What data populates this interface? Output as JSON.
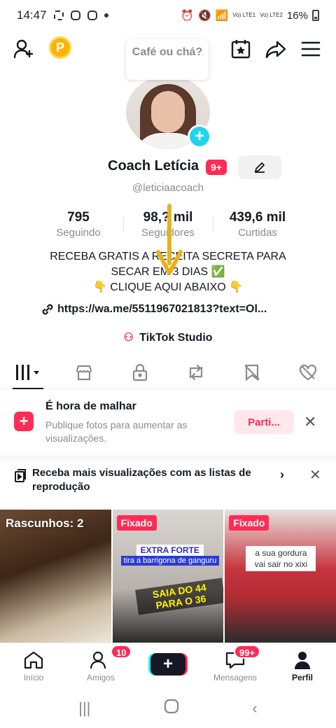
{
  "status_bar": {
    "time": "14:47",
    "sim1": "Vo) LTE1",
    "sim2": "Vo) LTE2",
    "battery": "16%"
  },
  "header": {
    "coin_letter": "P",
    "bubble_text": "Café ou chá?"
  },
  "profile": {
    "name": "Coach Letícia",
    "name_badge": "9+",
    "handle": "@leticiaacoach"
  },
  "stats": [
    {
      "value": "795",
      "label": "Seguindo"
    },
    {
      "value": "98,? mil",
      "label": "Seguidores"
    },
    {
      "value": "439,6 mil",
      "label": "Curtidas"
    }
  ],
  "bio": {
    "line1": "RECEBA GRATIS A RECEITA SECRETA PARA",
    "line2": "SECAR EM 3 DIAS ✅",
    "line3": "👇 CLIQUE AQUI ABAIXO 👇"
  },
  "link": "https://wa.me/5511967021813?text=Ol...",
  "studio_label": "TikTok Studio",
  "promo": {
    "title": "É hora de malhar",
    "subtitle": "Publique fotos para aumentar as visualizações.",
    "button": "Parti..."
  },
  "playlist_banner": "Receba mais visualizações com as listas de reprodução",
  "videos": {
    "drafts": "Rascunhos: 2",
    "pinned": "Fixado",
    "v2_overlay1": "EXTRA FORTE",
    "v2_overlay2": "tira a barrigona de ganguru",
    "v2_overlay3": "SAIA DO 44 PARA O 36",
    "v3_overlay": "a sua gordura vai sair no xixi"
  },
  "bottom_nav": {
    "home": "Início",
    "friends": "Amigos",
    "friends_count": "10",
    "messages": "Mensagens",
    "messages_count": "99+",
    "profile": "Perfil"
  },
  "colors": {
    "accent": "#fe2c55",
    "teal": "#20d5ec",
    "arrow": "#e8b21f"
  }
}
